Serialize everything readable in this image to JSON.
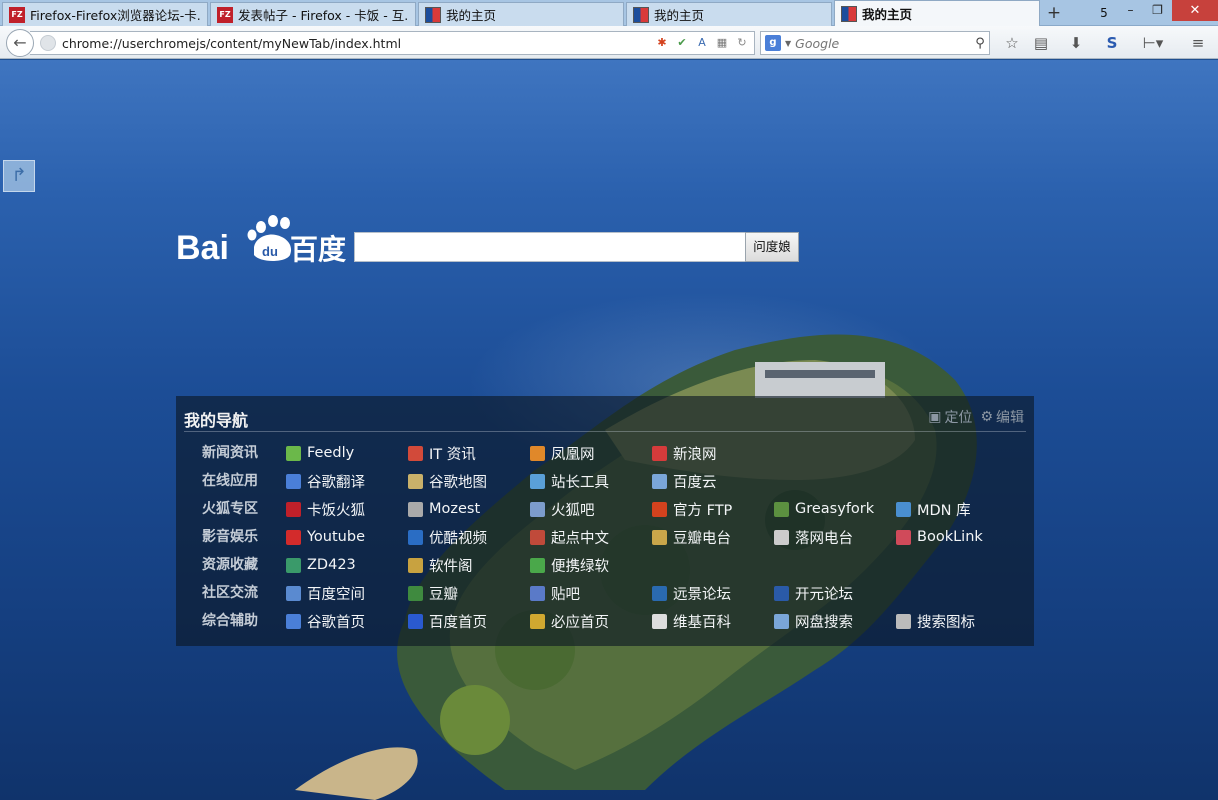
{
  "browser": {
    "tabs": [
      {
        "title": "Firefox-Firefox浏览器论坛-卡...",
        "favicon": "kafan-icon",
        "active": false
      },
      {
        "title": "发表帖子 - Firefox - 卡饭 - 互...",
        "favicon": "kafan-icon",
        "active": false
      },
      {
        "title": "我的主页",
        "favicon": "home-icon",
        "active": false
      },
      {
        "title": "我的主页",
        "favicon": "home-icon",
        "active": false
      },
      {
        "title": "我的主页",
        "favicon": "home-icon",
        "active": true
      }
    ],
    "new_tab": "+",
    "tab_count": "5",
    "window_controls": {
      "minimize": "–",
      "restore": "❐",
      "close": "✕"
    },
    "url": "chrome://userchromejs/content/myNewTab/index.html",
    "search_placeholder": "Google"
  },
  "baidu": {
    "logo_text": "Bai百度",
    "button": "问度娘"
  },
  "nav": {
    "title": "我的导航",
    "actions": {
      "locate": "定位",
      "edit": "编辑"
    },
    "categories": [
      {
        "name": "新闻资讯",
        "links": [
          {
            "label": "Feedly",
            "icon_color": "#6bb84a"
          },
          {
            "label": "IT 资讯",
            "icon_color": "#d24a3a"
          },
          {
            "label": "凤凰网",
            "icon_color": "#e0882a"
          },
          {
            "label": "新浪网",
            "icon_color": "#d63b3b"
          }
        ]
      },
      {
        "name": "在线应用",
        "links": [
          {
            "label": "谷歌翻译",
            "icon_color": "#4a7fd8"
          },
          {
            "label": "谷歌地图",
            "icon_color": "#c9b16a"
          },
          {
            "label": "站长工具",
            "icon_color": "#5aa0d8"
          },
          {
            "label": "百度云",
            "icon_color": "#7aa6d8"
          }
        ]
      },
      {
        "name": "火狐专区",
        "links": [
          {
            "label": "卡饭火狐",
            "icon_color": "#c0202a"
          },
          {
            "label": "Mozest",
            "icon_color": "#aaaaaa"
          },
          {
            "label": "火狐吧",
            "icon_color": "#7c9ccc"
          },
          {
            "label": "官方 FTP",
            "icon_color": "#d4421e"
          },
          {
            "label": "Greasyfork",
            "icon_color": "#5c9040"
          },
          {
            "label": "MDN 库",
            "icon_color": "#4a8fd0"
          }
        ]
      },
      {
        "name": "影音娱乐",
        "links": [
          {
            "label": "Youtube",
            "icon_color": "#d32b2b"
          },
          {
            "label": "优酷视频",
            "icon_color": "#2a6dc4"
          },
          {
            "label": "起点中文",
            "icon_color": "#c04a3a"
          },
          {
            "label": "豆瓣电台",
            "icon_color": "#c9a64a"
          },
          {
            "label": "落网电台",
            "icon_color": "#cccccc"
          },
          {
            "label": "BookLink",
            "icon_color": "#d04a5a"
          }
        ]
      },
      {
        "name": "资源收藏",
        "links": [
          {
            "label": "ZD423",
            "icon_color": "#3a9a6a"
          },
          {
            "label": "软件阁",
            "icon_color": "#c8a240"
          },
          {
            "label": "便携绿软",
            "icon_color": "#4aa84a"
          }
        ]
      },
      {
        "name": "社区交流",
        "links": [
          {
            "label": "百度空间",
            "icon_color": "#5a8ad0"
          },
          {
            "label": "豆瓣",
            "icon_color": "#3f8a3f"
          },
          {
            "label": "贴吧",
            "icon_color": "#5a7ac8"
          },
          {
            "label": "远景论坛",
            "icon_color": "#2a6ab0"
          },
          {
            "label": "开元论坛",
            "icon_color": "#2a5aa8"
          }
        ]
      },
      {
        "name": "综合辅助",
        "links": [
          {
            "label": "谷歌首页",
            "icon_color": "#4a7fd8"
          },
          {
            "label": "百度首页",
            "icon_color": "#2a5ad0"
          },
          {
            "label": "必应首页",
            "icon_color": "#d0a830"
          },
          {
            "label": "维基百科",
            "icon_color": "#dddddd"
          },
          {
            "label": "网盘搜索",
            "icon_color": "#7aa6d8"
          },
          {
            "label": "搜索图标",
            "icon_color": "#bbbbbb"
          }
        ]
      }
    ]
  }
}
